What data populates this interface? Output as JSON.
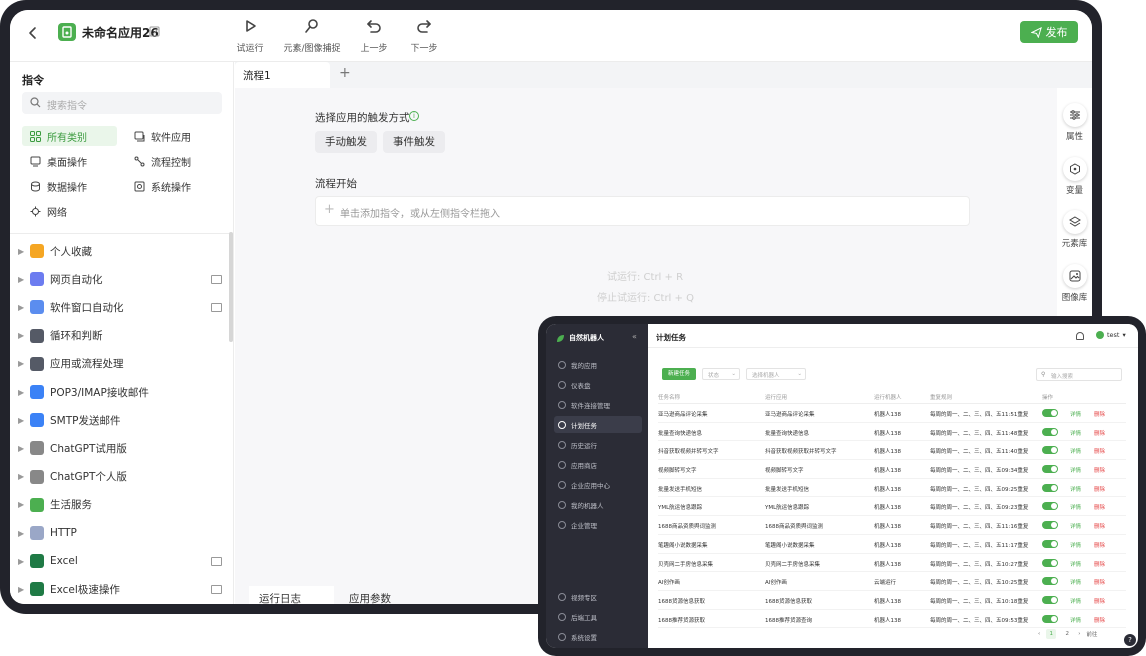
{
  "app": {
    "title": "未命名应用26",
    "publish_label": "发布"
  },
  "toolbar": {
    "items": [
      {
        "label": "试运行",
        "icon": "play-icon"
      },
      {
        "label": "元素/图像捕捉",
        "icon": "capture-icon"
      },
      {
        "label": "上一步",
        "icon": "undo-icon"
      },
      {
        "label": "下一步",
        "icon": "redo-icon"
      }
    ]
  },
  "sidebar": {
    "title": "指令",
    "search_placeholder": "搜索指令",
    "categories": [
      "所有类别",
      "软件应用",
      "桌面操作",
      "流程控制",
      "数据操作",
      "系统操作",
      "网络"
    ],
    "tree": [
      {
        "label": "个人收藏",
        "icon": "star-icon",
        "color": "#f5a623",
        "pc": false
      },
      {
        "label": "网页自动化",
        "icon": "browser-icon",
        "color": "#6c7cf0",
        "pc": true
      },
      {
        "label": "软件窗口自动化",
        "icon": "window-icon",
        "color": "#5b8def",
        "pc": true
      },
      {
        "label": "循环和判断",
        "icon": "loop-icon",
        "color": "#555a66",
        "pc": false
      },
      {
        "label": "应用或流程处理",
        "icon": "process-icon",
        "color": "#555a66",
        "pc": false
      },
      {
        "label": "POP3/IMAP接收邮件",
        "icon": "mail-icon",
        "color": "#3b82f6",
        "pc": false
      },
      {
        "label": "SMTP发送邮件",
        "icon": "mail-send-icon",
        "color": "#3b82f6",
        "pc": false
      },
      {
        "label": "ChatGPT试用版",
        "icon": "chatgpt-icon",
        "color": "#888888",
        "pc": false
      },
      {
        "label": "ChatGPT个人版",
        "icon": "chatgpt-icon",
        "color": "#888888",
        "pc": false
      },
      {
        "label": "生活服务",
        "icon": "life-icon",
        "color": "#4caf50",
        "pc": false
      },
      {
        "label": "HTTP",
        "icon": "http-icon",
        "color": "#9aa7c7",
        "pc": false
      },
      {
        "label": "Excel",
        "icon": "excel-icon",
        "color": "#1f7a45",
        "pc": true
      },
      {
        "label": "Excel极速操作",
        "icon": "excel-icon",
        "color": "#1f7a45",
        "pc": true
      }
    ]
  },
  "tabs": {
    "active": "流程1",
    "add": "+"
  },
  "canvas": {
    "trigger_label": "选择应用的触发方式",
    "trigger_buttons": [
      "手动触发",
      "事件触发"
    ],
    "flow_start": "流程开始",
    "add_placeholder": "单击添加指令，或从左侧指令栏拖入",
    "hints": [
      "试运行: Ctrl + R",
      "停止试运行: Ctrl + Q"
    ],
    "bottom_tabs": [
      "运行日志",
      "应用参数"
    ]
  },
  "right_panel": [
    {
      "label": "属性",
      "icon": "sliders-icon"
    },
    {
      "label": "变量",
      "icon": "variable-icon"
    },
    {
      "label": "元素库",
      "icon": "layers-icon"
    },
    {
      "label": "图像库",
      "icon": "image-icon"
    }
  ],
  "overlay": {
    "brand": "自然机器人",
    "header_title": "计划任务",
    "user": "test",
    "nav": [
      {
        "label": "我的应用",
        "active": false
      },
      {
        "label": "仪表盘",
        "active": false
      },
      {
        "label": "软件连接管理",
        "active": false
      },
      {
        "label": "计划任务",
        "active": true
      },
      {
        "label": "历史运行",
        "active": false
      },
      {
        "label": "应用商店",
        "active": false
      },
      {
        "label": "企业应用中心",
        "active": false
      },
      {
        "label": "我的机器人",
        "active": false
      },
      {
        "label": "企业管理",
        "active": false
      }
    ],
    "nav_bottom": [
      "视频专区",
      "后端工具",
      "系统设置"
    ],
    "new_button": "新建任务",
    "filter_status": "状态",
    "filter_robot": "选择机器人",
    "search_placeholder": "输入搜索",
    "columns": [
      "任务名称",
      "运行应用",
      "运行机器人",
      "重复规则",
      "操作"
    ],
    "detail_label": "详情",
    "delete_label": "删除",
    "rows": [
      {
        "name": "亚马逊商品评论采集",
        "app": "亚马逊商品评论采集",
        "robot": "机器人138",
        "rule": "每周的周一、二、三、四、五11:51重复"
      },
      {
        "name": "批量查询快递信息",
        "app": "批量查询快递信息",
        "robot": "机器人138",
        "rule": "每周的周一、二、三、四、五11:48重复"
      },
      {
        "name": "抖音获取视频并转写文字",
        "app": "抖音获取视频获取并转写文字",
        "robot": "机器人138",
        "rule": "每周的周一、二、三、四、五11:40重复"
      },
      {
        "name": "视频脚转写文字",
        "app": "视频脚转写文字",
        "robot": "机器人138",
        "rule": "每周的周一、二、三、四、五09:34重复"
      },
      {
        "name": "批量发送手机短信",
        "app": "批量发送手机短信",
        "robot": "机器人138",
        "rule": "每周的周一、二、三、四、五09:25重复"
      },
      {
        "name": "YML航运信息跟踪",
        "app": "YML航运信息跟踪",
        "robot": "机器人138",
        "rule": "每周的周一、二、三、四、五09:23重复"
      },
      {
        "name": "1688商品资质舆词监测",
        "app": "1688商品资质舆词监测",
        "robot": "机器人138",
        "rule": "每周的周一、二、三、四、五11:16重复"
      },
      {
        "name": "笔趣阁小说数据采集",
        "app": "笔趣阁小说数据采集",
        "robot": "机器人138",
        "rule": "每周的周一、二、三、四、五11:17重复"
      },
      {
        "name": "贝壳网二手房信息采集",
        "app": "贝壳网二手房信息采集",
        "robot": "机器人138",
        "rule": "每周的周一、二、三、四、五10:27重复"
      },
      {
        "name": "AI创作画",
        "app": "AI创作画",
        "robot": "云端运行",
        "rule": "每周的周一、二、三、四、五10:25重复"
      },
      {
        "name": "1688货源信息获取",
        "app": "1688货源信息获取",
        "robot": "机器人138",
        "rule": "每周的周一、二、三、四、五10:18重复"
      },
      {
        "name": "1688推荐货源获取",
        "app": "1688推荐货源查询",
        "robot": "机器人138",
        "rule": "每周的周一、二、三、四、五09:53重复"
      }
    ],
    "pager": [
      "1",
      "2",
      "前往"
    ]
  }
}
